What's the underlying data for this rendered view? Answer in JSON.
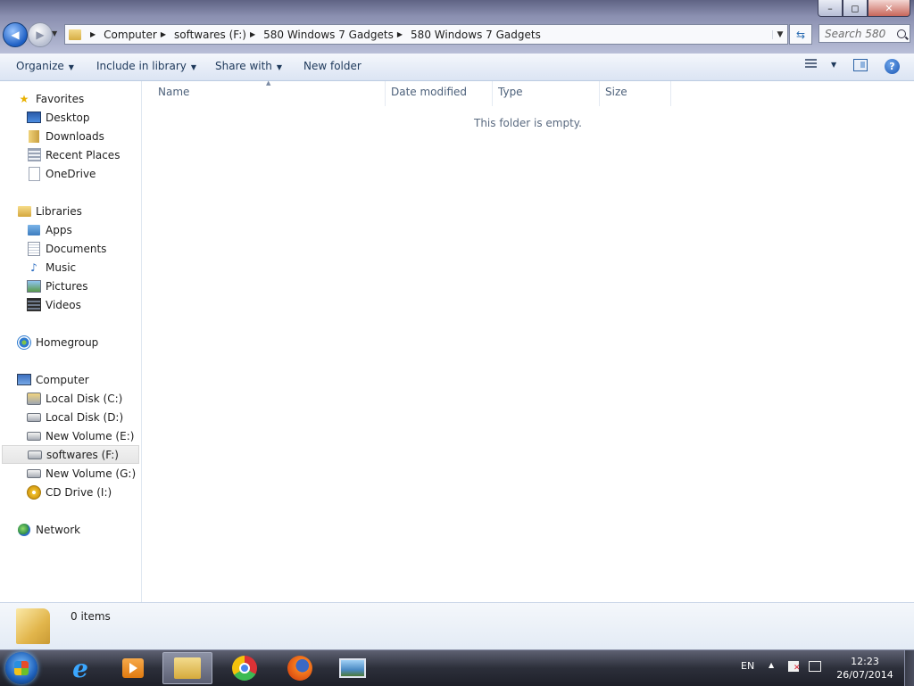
{
  "window": {
    "caption": {
      "minimize": "–",
      "maximize": "◻",
      "close": "✕"
    }
  },
  "address_bar": {
    "breadcrumbs": [
      "Computer",
      "softwares (F:)",
      "580 Windows 7 Gadgets",
      "580 Windows 7 Gadgets"
    ]
  },
  "search": {
    "placeholder": "Search 580 ..."
  },
  "toolbar": {
    "organize": "Organize",
    "include_in_library": "Include in library",
    "share_with": "Share with",
    "new_folder": "New folder"
  },
  "nav": {
    "favorites": {
      "label": "Favorites",
      "items": [
        "Desktop",
        "Downloads",
        "Recent Places",
        "OneDrive"
      ]
    },
    "libraries": {
      "label": "Libraries",
      "items": [
        "Apps",
        "Documents",
        "Music",
        "Pictures",
        "Videos"
      ]
    },
    "homegroup": {
      "label": "Homegroup"
    },
    "computer": {
      "label": "Computer",
      "items": [
        "Local Disk (C:)",
        "Local Disk (D:)",
        "New Volume (E:)",
        "softwares (F:)",
        "New Volume (G:)",
        "CD Drive (I:)"
      ],
      "selected": "softwares (F:)"
    },
    "network": {
      "label": "Network"
    }
  },
  "content": {
    "columns": [
      "Name",
      "Date modified",
      "Type",
      "Size"
    ],
    "empty_message": "This folder is empty."
  },
  "details": {
    "item_count": "0 items"
  },
  "taskbar": {
    "apps": [
      {
        "name": "Internet Explorer",
        "active": false
      },
      {
        "name": "Windows Media Player",
        "active": false
      },
      {
        "name": "Windows Explorer",
        "active": true
      },
      {
        "name": "Google Chrome",
        "active": false
      },
      {
        "name": "Mozilla Firefox",
        "active": false
      },
      {
        "name": "Photo Viewer",
        "active": false
      }
    ],
    "language": "EN",
    "time": "12:23",
    "date": "26/07/2014"
  }
}
